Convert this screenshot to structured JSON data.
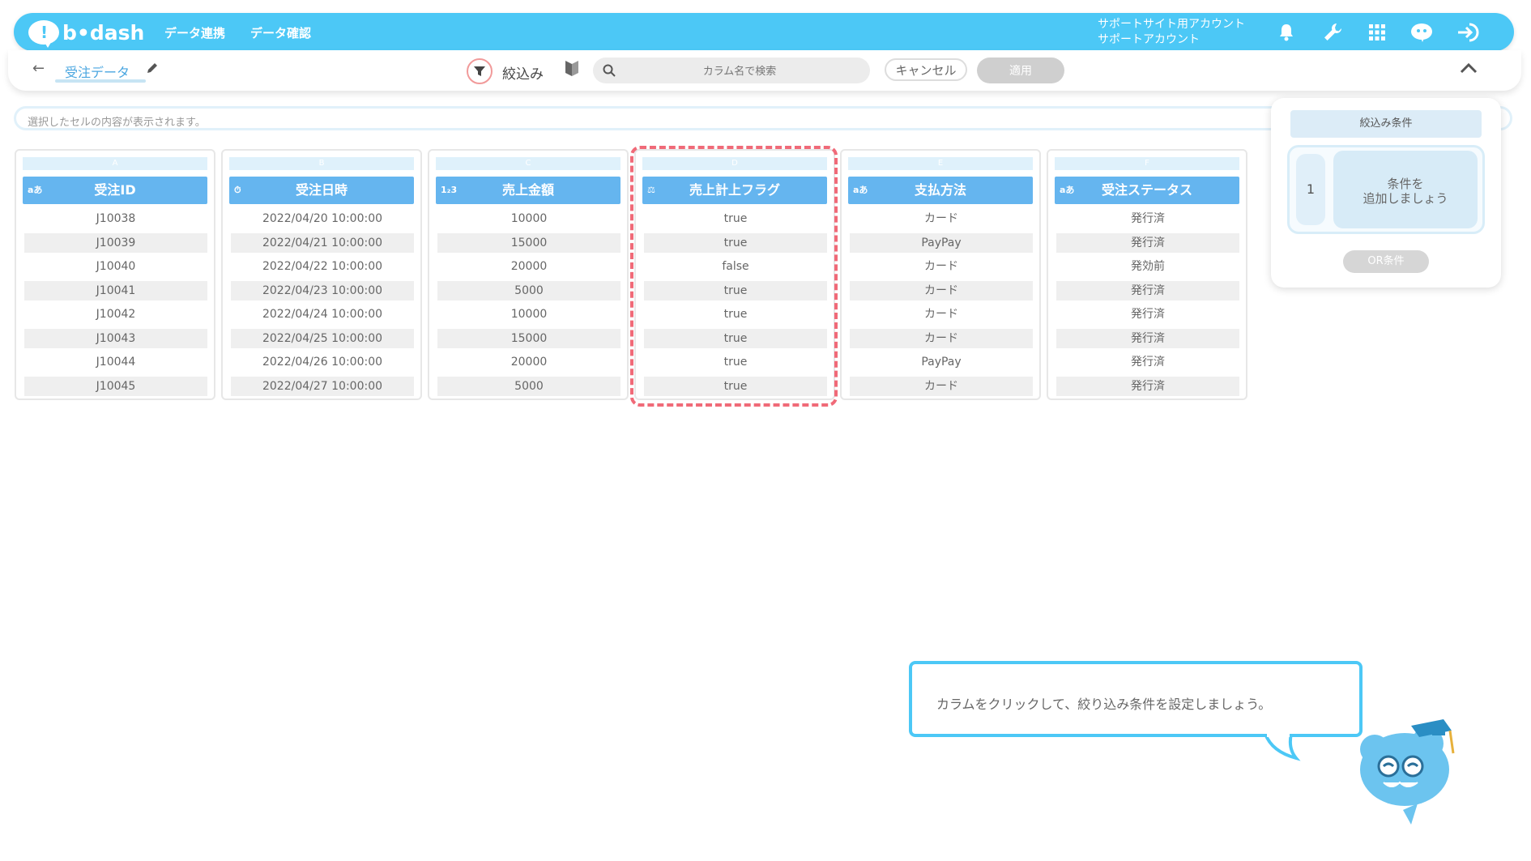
{
  "app": {
    "logo_text": "b•dash"
  },
  "nav": {
    "items": [
      "データ連携",
      "データ確認"
    ]
  },
  "account": {
    "line1": "サポートサイト用アカウント",
    "line2": "サポートアカウント"
  },
  "page": {
    "title": "受注データ"
  },
  "toolbar": {
    "filter_label": "絞込み",
    "search_placeholder": "カラム名で検索",
    "cancel_label": "キャンセル",
    "apply_label": "適用"
  },
  "cellbar": {
    "text": "選択したセルの内容が表示されます。"
  },
  "columns": [
    {
      "letter": "A",
      "type_icon": "aあ",
      "name": "受注ID",
      "cells": [
        "J10038",
        "J10039",
        "J10040",
        "J10041",
        "J10042",
        "J10043",
        "J10044",
        "J10045"
      ]
    },
    {
      "letter": "B",
      "type_icon": "⏱",
      "name": "受注日時",
      "cells": [
        "2022/04/20 10:00:00",
        "2022/04/21 10:00:00",
        "2022/04/22 10:00:00",
        "2022/04/23 10:00:00",
        "2022/04/24 10:00:00",
        "2022/04/25 10:00:00",
        "2022/04/26 10:00:00",
        "2022/04/27 10:00:00"
      ]
    },
    {
      "letter": "C",
      "type_icon": "1₂3",
      "name": "売上金額",
      "cells": [
        "10000",
        "15000",
        "20000",
        "5000",
        "10000",
        "15000",
        "20000",
        "5000"
      ]
    },
    {
      "letter": "D",
      "type_icon": "⚖",
      "name": "売上計上フラグ",
      "cells": [
        "true",
        "true",
        "false",
        "true",
        "true",
        "true",
        "true",
        "true"
      ]
    },
    {
      "letter": "E",
      "type_icon": "aあ",
      "name": "支払方法",
      "cells": [
        "カード",
        "PayPay",
        "カード",
        "カード",
        "カード",
        "カード",
        "PayPay",
        "カード"
      ]
    },
    {
      "letter": "F",
      "type_icon": "aあ",
      "name": "受注ステータス",
      "cells": [
        "発行済",
        "発行済",
        "発効前",
        "発行済",
        "発行済",
        "発行済",
        "発行済",
        "発行済"
      ]
    }
  ],
  "filter_panel": {
    "title": "絞込み条件",
    "group_number": "1",
    "add_condition_line1": "条件を",
    "add_condition_line2": "追加しましょう",
    "or_button": "OR条件"
  },
  "tooltip": {
    "text": "カラムをクリックして、絞り込み条件を設定しましょう。"
  },
  "colors": {
    "brand": "#4cc8f6",
    "header": "#65b5ef",
    "highlight": "#f06a78"
  }
}
